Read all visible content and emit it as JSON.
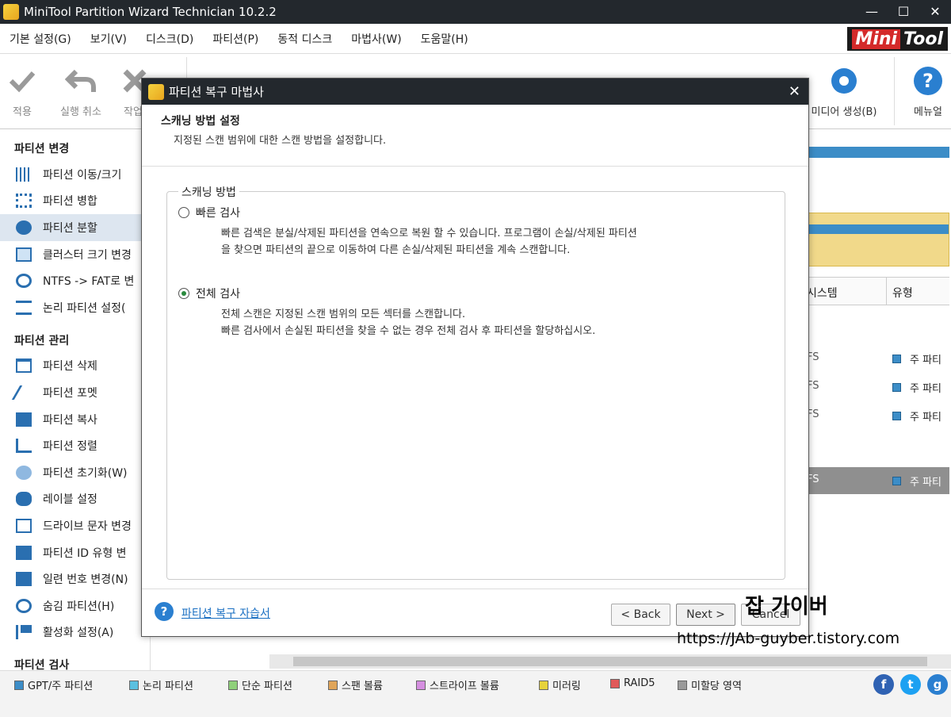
{
  "window": {
    "title": "MiniTool Partition Wizard Technician 10.2.2",
    "controls": [
      "—",
      "☐",
      "✕"
    ]
  },
  "brand": {
    "mini": "Mini",
    "tool": "Tool"
  },
  "menu": [
    "기본 설정(G)",
    "보기(V)",
    "디스크(D)",
    "파티션(P)",
    "동적 디스크",
    "마법사(W)",
    "도움말(H)"
  ],
  "toolbar": {
    "apply": "적용",
    "undo": "실행 취소",
    "discard": "작업",
    "media": "미디어 생성(B)",
    "manual": "메뉴얼"
  },
  "sidebar": {
    "header_change": "파티션 변경",
    "change_items": [
      "파티션 이동/크기",
      "파티션 병합",
      "파티션 분할",
      "클러스터 크기 변경",
      "NTFS -> FAT로 변",
      "논리 파티션 설정("
    ],
    "header_manage": "파티션 관리",
    "manage_items": [
      "파티션 삭제",
      "파티션 포멧",
      "파티션 복사",
      "파티션 정렬",
      "파티션 초기화(W)",
      "레이블 설정",
      "드라이브 문자 변경",
      "파티션 ID 유형 변",
      "일련 번호 변경(N)",
      "숨김 파티션(H)",
      "활성화 설정(A)"
    ],
    "header_check": "파티션 검사"
  },
  "grid": {
    "col_fs": "시스템",
    "col_type": "유형",
    "rows": [
      {
        "fs": "FS",
        "type": "주 파티"
      },
      {
        "fs": "FS",
        "type": "주 파티"
      },
      {
        "fs": "FS",
        "type": "주 파티"
      },
      {
        "fs": "FS",
        "type": "주 파티"
      }
    ]
  },
  "legend": [
    "GPT/주 파티션",
    "논리 파티션",
    "단순 파티션",
    "스팬 볼륨",
    "스트라이프 볼륨",
    "미러링",
    "RAID5",
    "미할당 영역"
  ],
  "legend_colors": [
    "#3c8dc7",
    "#5bc0e0",
    "#8fd07a",
    "#e0a55a",
    "#d58fe0",
    "#e6d23a",
    "#e05a5a",
    "#9a9a9a"
  ],
  "dialog": {
    "title": "파티션 복구 마법사",
    "close": "✕",
    "heading": "스캐닝 방법 설정",
    "subheading": "지정된 스캔 범위에 대한 스캔 방법을 설정합니다.",
    "group_label": "스캐닝 방법",
    "options": [
      {
        "label": "빠른 검사",
        "selected": false,
        "desc1": "빠른 검색은 분실/삭제된 파티션을 연속으로 복원 할 수 있습니다. 프로그램이 손실/삭제된 파티션",
        "desc2": "을 찾으면 파티션의 끝으로 이동하여 다른 손실/삭제된 파티션을 계속 스캔합니다."
      },
      {
        "label": "전체 검사",
        "selected": true,
        "desc1": "전체 스캔은 지정된 스캔 범위의 모든 섹터를 스캔합니다.",
        "desc2": "빠른 검사에서 손실된 파티션을 찾을 수 없는 경우 전체 검사 후 파티션을 할당하십시오."
      }
    ],
    "help_link": "파티션 복구 자습서",
    "back": "< Back",
    "next": "Next >",
    "cancel": "Cancel"
  },
  "watermark": {
    "line1": "잡 가이버",
    "line2": "https://JAb-guyber.tistory.com"
  }
}
